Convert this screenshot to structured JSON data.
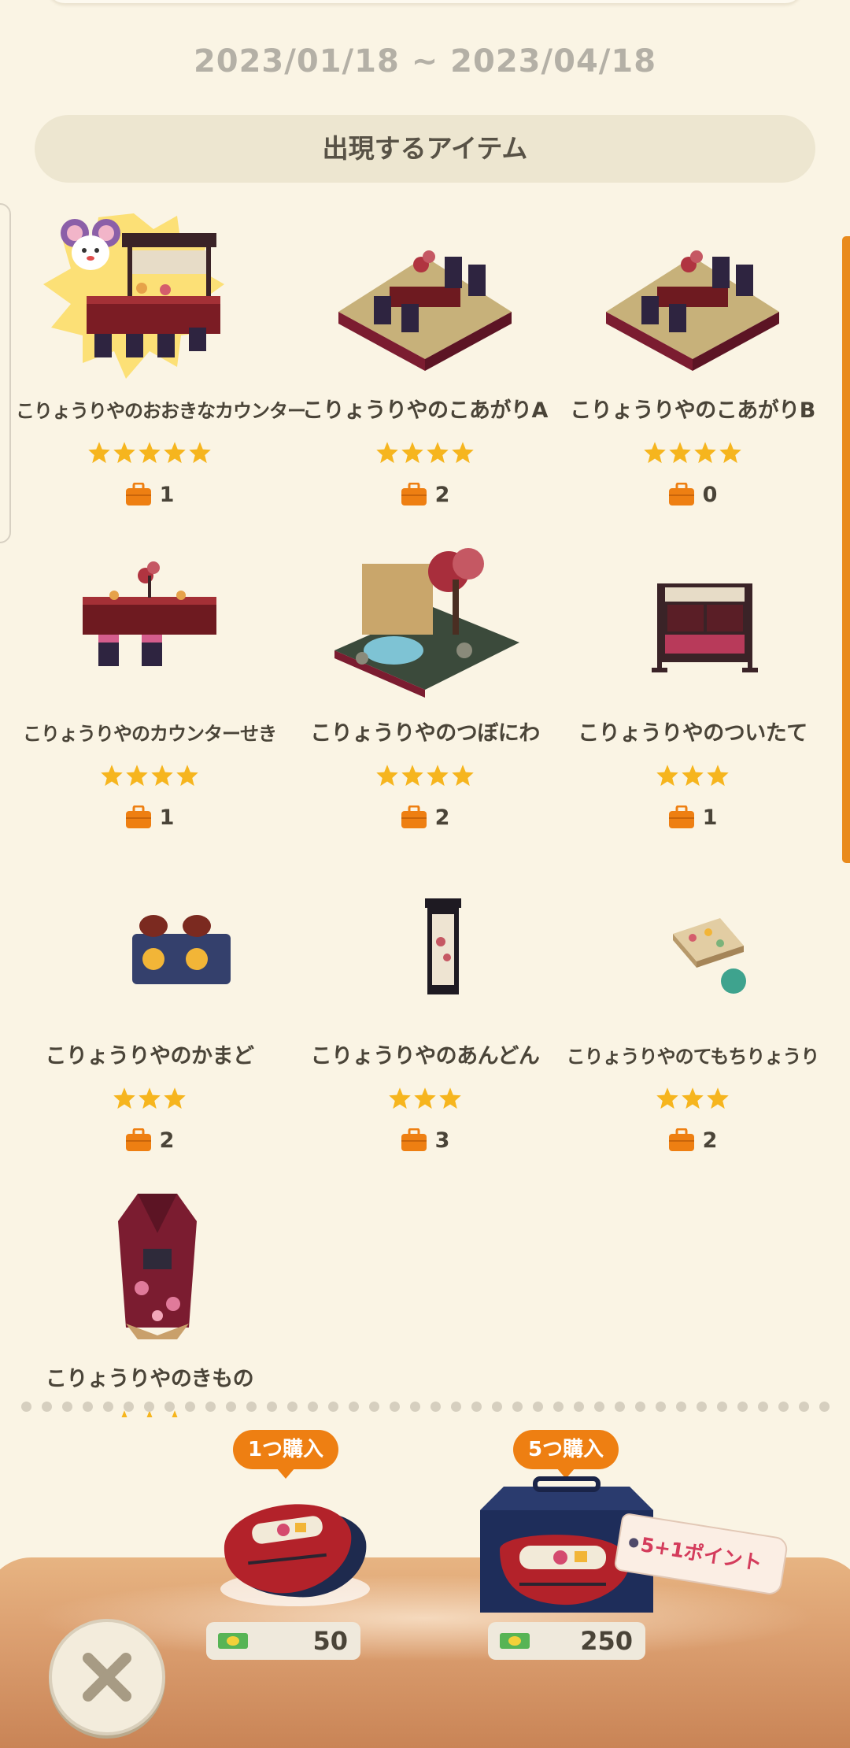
{
  "period": {
    "date_range": "2023/01/18 ~ 2023/04/18"
  },
  "section": {
    "title": "出現するアイテム"
  },
  "items": [
    {
      "name": "こりょうりやのおおきなカウンター",
      "stars": 5,
      "owned": "1",
      "featured": true
    },
    {
      "name": "こりょうりやのこあがりA",
      "stars": 4,
      "owned": "2"
    },
    {
      "name": "こりょうりやのこあがりB",
      "stars": 4,
      "owned": "0"
    },
    {
      "name": "こりょうりやのカウンターせき",
      "stars": 4,
      "owned": "1"
    },
    {
      "name": "こりょうりやのつぼにわ",
      "stars": 4,
      "owned": "2"
    },
    {
      "name": "こりょうりやのついたて",
      "stars": 3,
      "owned": "1"
    },
    {
      "name": "こりょうりやのかまど",
      "stars": 3,
      "owned": "2"
    },
    {
      "name": "こりょうりやのあんどん",
      "stars": 3,
      "owned": "3"
    },
    {
      "name": "こりょうりやのてもちりょうり",
      "stars": 3,
      "owned": "2"
    },
    {
      "name": "こりょうりやのきもの",
      "stars": 3,
      "owned": ""
    }
  ],
  "purchase": {
    "single": {
      "tag": "1つ購入",
      "price": "50"
    },
    "bundle": {
      "tag": "5つ購入",
      "price": "250",
      "bonus": "5+1ポイント"
    }
  },
  "colors": {
    "accent": "#ee7f12",
    "star": "#f6b51e",
    "background": "#faf4e4"
  }
}
